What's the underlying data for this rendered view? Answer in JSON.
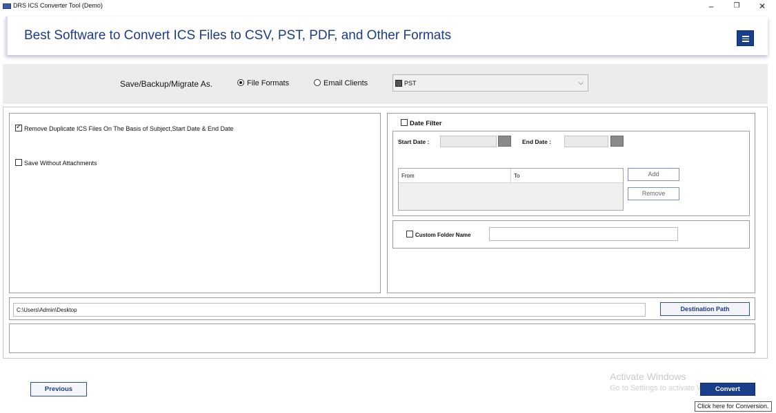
{
  "window": {
    "title": "DRS ICS Converter Tool (Demo)",
    "minimize_glyph": "–",
    "restore_glyph": "❐",
    "close_glyph": "✕"
  },
  "header": {
    "title": "Best Software to Convert ICS Files to CSV, PST, PDF, and Other Formats",
    "menu_icon": "hamburger-menu-icon",
    "accent_color": "#1a3f8a"
  },
  "save_as": {
    "label": "Save/Backup/Migrate As.",
    "options": [
      {
        "label": "File Formats",
        "selected": true
      },
      {
        "label": "Email Clients",
        "selected": false
      }
    ],
    "format_select": {
      "value": "PST",
      "icon": "pst-file-icon"
    }
  },
  "options": {
    "remove_duplicates": {
      "label": "Remove Duplicate ICS Files On The Basis of Subject,Start Date & End Date",
      "checked": true
    },
    "save_without_attachments": {
      "label": "Save Without Attachments",
      "checked": false
    }
  },
  "date_filter": {
    "label": "Date Filter",
    "checked": false,
    "start_date_label": "Start Date :",
    "end_date_label": "End Date :",
    "table_headers": [
      "From",
      "To"
    ],
    "add_label": "Add",
    "remove_label": "Remove"
  },
  "custom_folder": {
    "label": "Custom Folder Name",
    "checked": false,
    "value": ""
  },
  "destination": {
    "path": "C:\\Users\\Admin\\Desktop",
    "button_label": "Destination Path"
  },
  "footer": {
    "previous_label": "Previous",
    "convert_label": "Convert",
    "convert_tooltip": "Click here for Conversion.",
    "watermark_title": "Activate Windows",
    "watermark_text": "Go to Settings to activate Windows."
  }
}
